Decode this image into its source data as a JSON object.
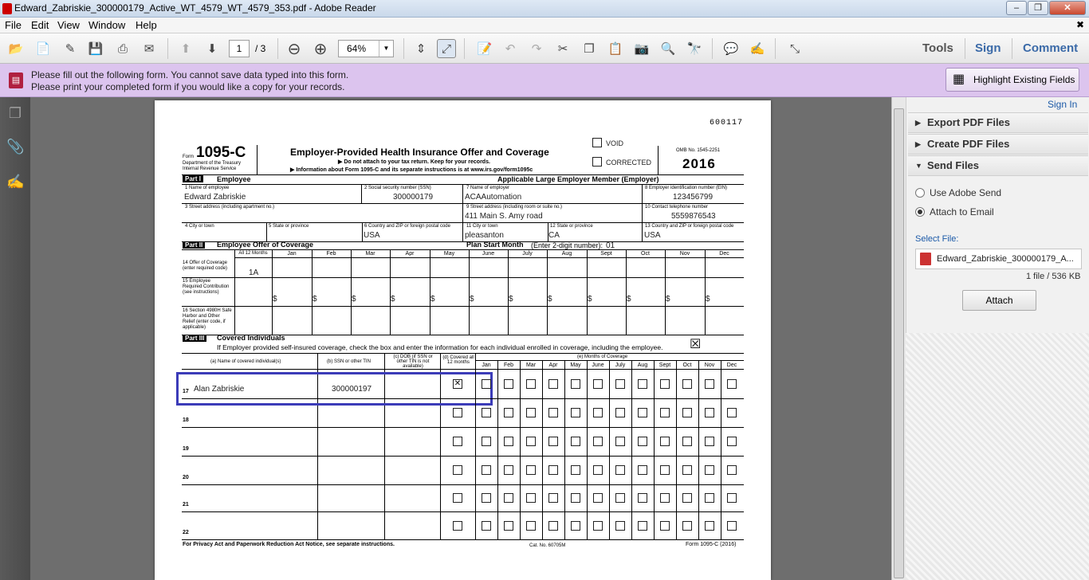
{
  "window": {
    "title": "Edward_Zabriskie_300000179_Active_WT_4579_WT_4579_353.pdf - Adobe Reader",
    "min": "‒",
    "max": "❐",
    "close": "✕"
  },
  "menu": {
    "items": [
      "File",
      "Edit",
      "View",
      "Window",
      "Help"
    ],
    "close": "✖"
  },
  "toolbar": {
    "page_current": "1",
    "page_total": "/ 3",
    "zoom": "64%",
    "tools": "Tools",
    "sign": "Sign",
    "comment": "Comment"
  },
  "notice": {
    "line1": "Please fill out the following form. You cannot save data typed into this form.",
    "line2": "Please print your completed form if you would like a copy for your records.",
    "highlight_button": "Highlight Existing Fields"
  },
  "panel": {
    "sign_in": "Sign In",
    "export": "Export PDF Files",
    "create": "Create PDF Files",
    "send": "Send Files",
    "opt_adobe": "Use Adobe Send",
    "opt_email": "Attach to Email",
    "select_file_label": "Select File:",
    "file_name": "Edward_Zabriskie_300000179_A...",
    "file_info": "1 file / 536 KB",
    "attach": "Attach"
  },
  "form": {
    "code": "600117",
    "form_label": "Form",
    "form_number": "1095-C",
    "dept1": "Department of the Treasury",
    "dept2": "Internal Revenue Service",
    "title": "Employer-Provided Health Insurance Offer and Coverage",
    "sub1": "▶ Do not attach to your tax return. Keep for your records.",
    "sub2": "▶ Information about Form 1095-C and its separate instructions is at www.irs.gov/form1095c",
    "void": "VOID",
    "corrected": "CORRECTED",
    "omb": "OMB No. 1545-2251",
    "year": "2016",
    "part1": "Part I",
    "part1_title": "Employee",
    "part1_employer": "Applicable Large Employer Member (Employer)",
    "l1": "1  Name of employee",
    "v1": "Edward Zabriskie",
    "l2": "2  Social security number (SSN)",
    "v2": "300000179",
    "l7": "7  Name of employer",
    "v7": "ACAAutomation",
    "l8": "8  Employer identification number (EIN)",
    "v8": "123456799",
    "l3": "3  Street address (including apartment no.)",
    "l9": "9  Street address (including room or suite no.)",
    "v9": "411 Main S. Amy road",
    "l10": "10  Contact telephone number",
    "v10": "5559876543",
    "l4": "4  City or town",
    "l5": "5  State or province",
    "l6": "6  Country and ZIP or foreign postal code",
    "v6": "USA",
    "l11": "11  City or town",
    "v11": "pleasanton",
    "l12": "12  State or province",
    "v12": "CA",
    "l13": "13  Country and ZIP or foreign postal code",
    "v13": "USA",
    "part2": "Part II",
    "part2_title": "Employee Offer of Coverage",
    "plan_start": "Plan Start Month",
    "plan_start_note": "(Enter 2-digit number):",
    "plan_start_val": "01",
    "months_head": [
      "All 12 Months",
      "Jan",
      "Feb",
      "Mar",
      "Apr",
      "May",
      "June",
      "July",
      "Aug",
      "Sept",
      "Oct",
      "Nov",
      "Dec"
    ],
    "l14": "14  Offer of Coverage (enter required code)",
    "v14": "1A",
    "l15": "15  Employee Required Contribution (see instructions)",
    "dollar": "$",
    "l16": "16  Section 4980H Safe Harbor and Other Relief (enter code, if applicable)",
    "part3": "Part III",
    "part3_title": "Covered Individuals",
    "part3_note": "If Employer provided self-insured coverage, check the box and enter the information for each individual enrolled in coverage, including the employee.",
    "ca": "(a) Name of covered individual(s)",
    "cb": "(b) SSN or other TIN",
    "cc": "(c) DOB (if SSN or other TIN is not available)",
    "cd": "(d) Covered all 12 months",
    "ce": "(e) Months of Coverage",
    "months_short": [
      "Jan",
      "Feb",
      "Mar",
      "Apr",
      "May",
      "June",
      "July",
      "Aug",
      "Sept",
      "Oct",
      "Nov",
      "Dec"
    ],
    "rows": [
      {
        "num": "17",
        "name": "Alan Zabriskie",
        "ssn": "300000197",
        "all12": true
      },
      {
        "num": "18",
        "name": "",
        "ssn": "",
        "all12": false
      },
      {
        "num": "19",
        "name": "",
        "ssn": "",
        "all12": false
      },
      {
        "num": "20",
        "name": "",
        "ssn": "",
        "all12": false
      },
      {
        "num": "21",
        "name": "",
        "ssn": "",
        "all12": false
      },
      {
        "num": "22",
        "name": "",
        "ssn": "",
        "all12": false
      }
    ],
    "footer1": "For Privacy Act and Paperwork Reduction Act Notice, see separate instructions.",
    "footer2": "Cat. No. 60705M",
    "footer3": "Form 1095-C (2016)",
    "check": "☒"
  },
  "colors": {
    "notice_bg": "#dcc4ee",
    "focus_box": "#3b3bb8",
    "link": "#1c5aa8"
  }
}
